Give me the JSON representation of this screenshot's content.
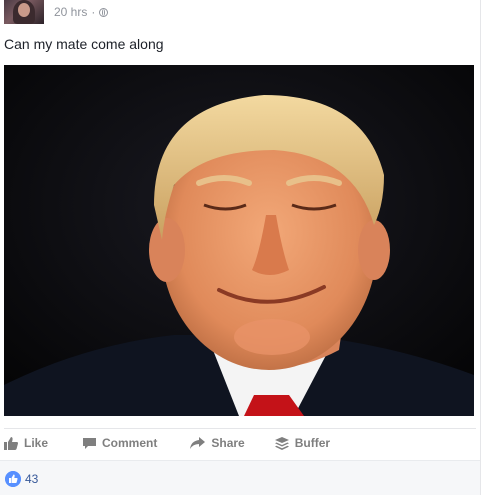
{
  "post": {
    "timestamp": "20 hrs",
    "separator": "·",
    "privacy_icon": "globe-icon",
    "text": "Can my mate come along"
  },
  "actions": {
    "like_label": "Like",
    "comment_label": "Comment",
    "share_label": "Share",
    "buffer_label": "Buffer"
  },
  "reactions": {
    "icon": "thumbs-up-icon",
    "count": "43"
  },
  "colors": {
    "link": "#365899",
    "action_text": "#7f7f7f",
    "like_badge": "#5890ff",
    "meta_text": "#90949c"
  }
}
